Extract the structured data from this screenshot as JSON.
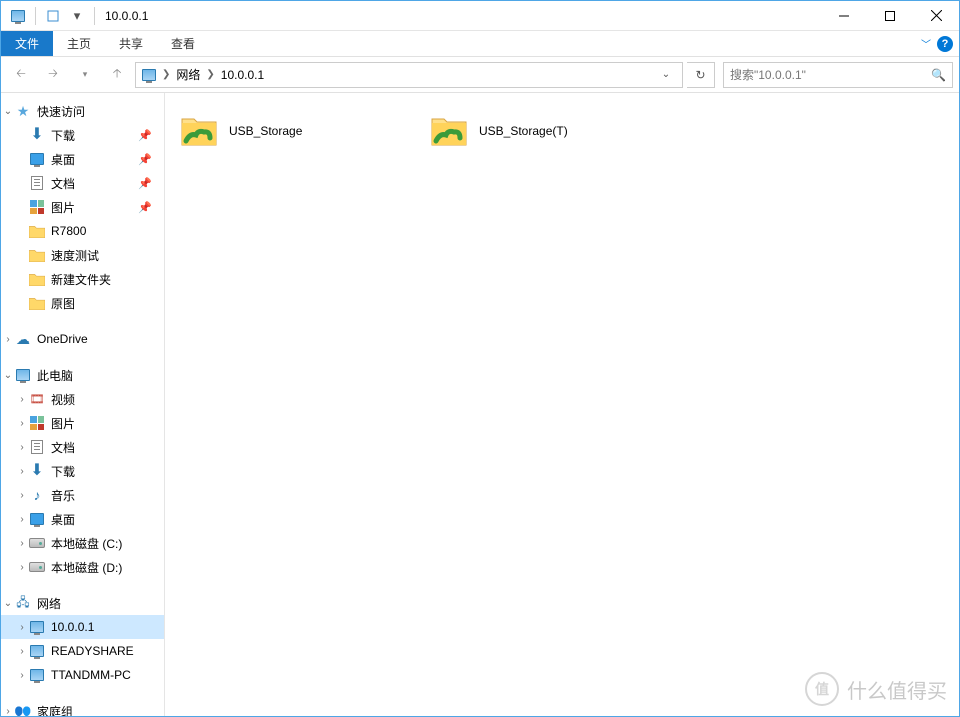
{
  "title": "10.0.0.1",
  "ribbon": {
    "file": "文件",
    "tabs": [
      "主页",
      "共享",
      "查看"
    ]
  },
  "breadcrumb": {
    "segments": [
      "网络",
      "10.0.0.1"
    ]
  },
  "search": {
    "placeholder": "搜索\"10.0.0.1\""
  },
  "sidebar": {
    "quickAccess": {
      "label": "快速访问",
      "pinned": [
        {
          "label": "下载",
          "icon": "download"
        },
        {
          "label": "桌面",
          "icon": "desktop"
        },
        {
          "label": "文档",
          "icon": "document"
        },
        {
          "label": "图片",
          "icon": "pictures"
        }
      ],
      "recent": [
        {
          "label": "R7800"
        },
        {
          "label": "速度测试"
        },
        {
          "label": "新建文件夹"
        },
        {
          "label": "原图"
        }
      ]
    },
    "oneDrive": {
      "label": "OneDrive"
    },
    "thisPC": {
      "label": "此电脑",
      "children": [
        {
          "label": "视频",
          "icon": "video"
        },
        {
          "label": "图片",
          "icon": "pictures"
        },
        {
          "label": "文档",
          "icon": "document"
        },
        {
          "label": "下载",
          "icon": "download"
        },
        {
          "label": "音乐",
          "icon": "music"
        },
        {
          "label": "桌面",
          "icon": "desktop"
        },
        {
          "label": "本地磁盘 (C:)",
          "icon": "drive"
        },
        {
          "label": "本地磁盘 (D:)",
          "icon": "drive"
        }
      ]
    },
    "network": {
      "label": "网络",
      "children": [
        {
          "label": "10.0.0.1",
          "selected": true
        },
        {
          "label": "READYSHARE"
        },
        {
          "label": "TTANDMM-PC"
        }
      ]
    },
    "homegroup": {
      "label": "家庭组"
    }
  },
  "content": {
    "items": [
      {
        "label": "USB_Storage"
      },
      {
        "label": "USB_Storage(T)"
      }
    ]
  },
  "watermark": "什么值得买"
}
